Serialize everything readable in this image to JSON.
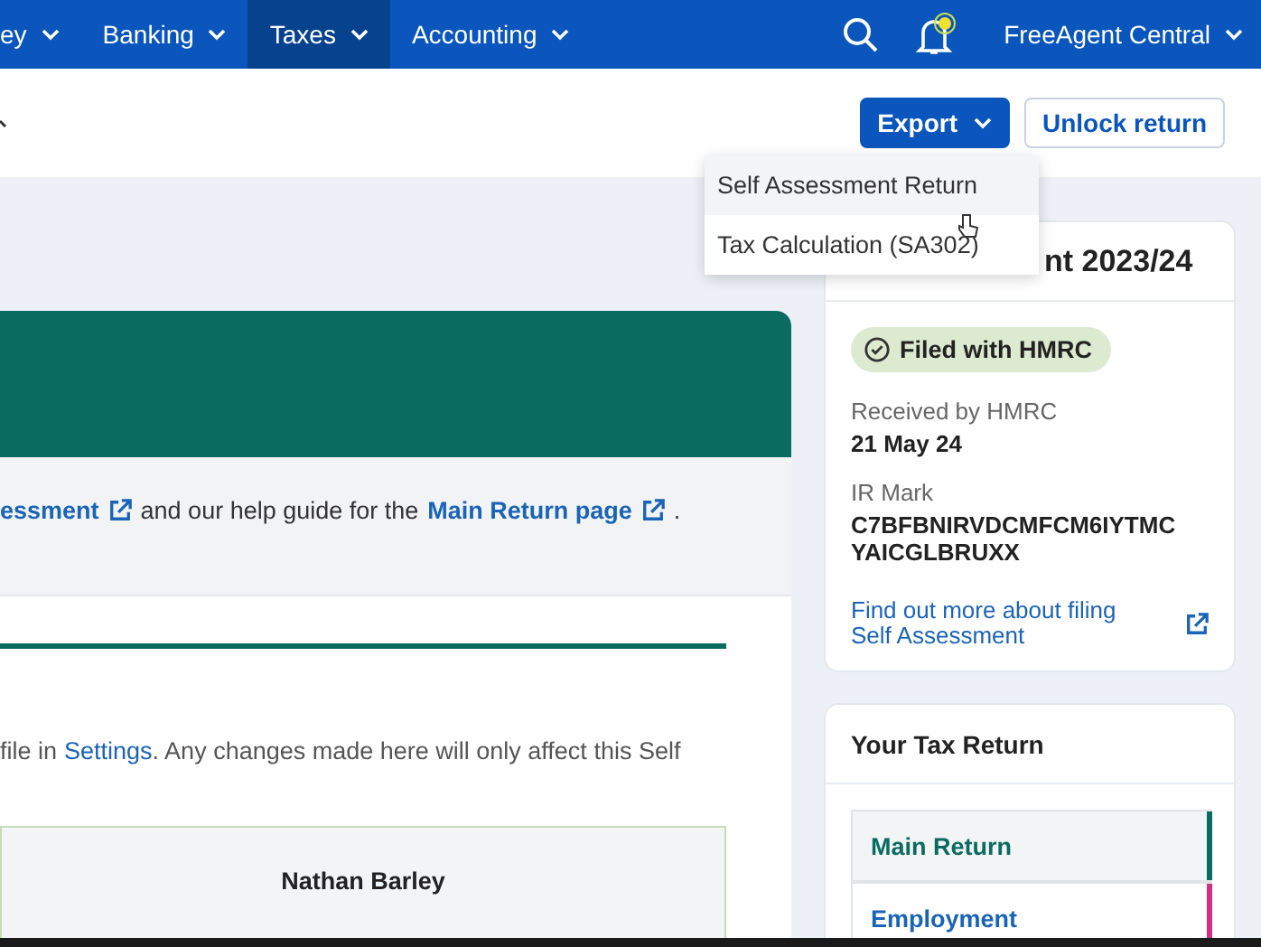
{
  "nav": {
    "items": [
      {
        "label": "ey",
        "selected": false
      },
      {
        "label": "Banking",
        "selected": false
      },
      {
        "label": "Taxes",
        "selected": true
      },
      {
        "label": "Accounting",
        "selected": false
      }
    ],
    "account": "FreeAgent Central",
    "notification": true
  },
  "toolbar": {
    "buttons": [
      {
        "label": "Export",
        "kind": "primary"
      },
      {
        "label": "Unlock return",
        "kind": "secondary"
      }
    ]
  },
  "export_menu": {
    "items": [
      "Self Assessment Return",
      "Tax Calculation (SA302)"
    ]
  },
  "main": {
    "info_parts": [
      {
        "kind": "link",
        "text": "essment"
      },
      {
        "kind": "text",
        "text": "and our help guide for the"
      },
      {
        "kind": "link",
        "text": "Main Return page"
      },
      {
        "kind": "text",
        "text": "."
      }
    ],
    "note_parts": [
      {
        "kind": "text",
        "text": "file in"
      },
      {
        "kind": "link",
        "text": "Settings"
      },
      {
        "kind": "text",
        "text": ". Any changes made here will only affect this Self"
      }
    ],
    "name": "Nathan Barley"
  },
  "status_card": {
    "title": "nt 2023/24",
    "badge": "Filed with HMRC",
    "received_label": "Received by HMRC",
    "received_date": "21 May 24",
    "ir_label": "IR Mark",
    "ir_value": "C7BFBNIRVDCMFCM6IYTMC YAICGLBRUXX",
    "link": "Find out more about filing Self Assessment"
  },
  "return_card": {
    "title": "Your Tax Return",
    "items": [
      {
        "label": "Main Return",
        "selected": true,
        "color": "#0a6b60"
      },
      {
        "label": "Employment",
        "selected": false,
        "color": "#d0307f"
      }
    ]
  }
}
